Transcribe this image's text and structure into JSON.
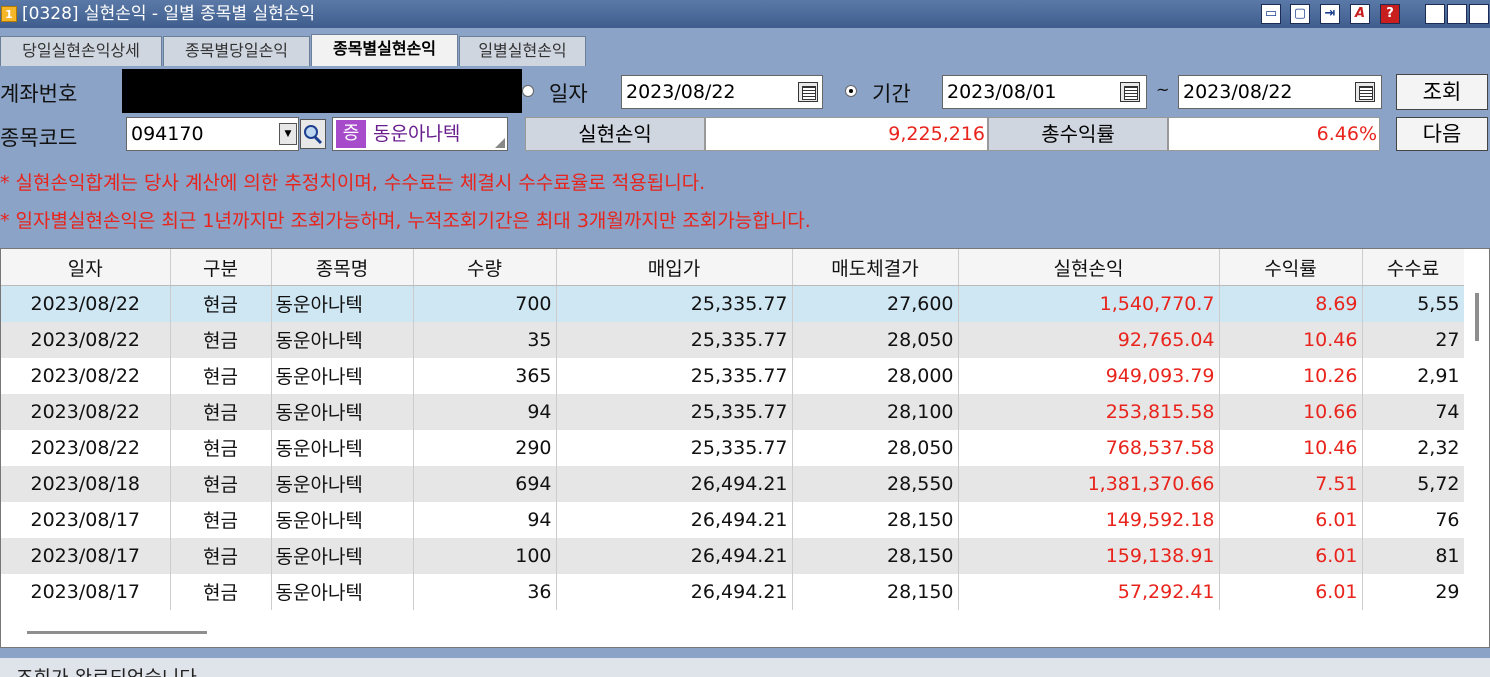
{
  "window": {
    "icon_text": "1",
    "title": "[0328] 실현손익 - 일별 종목별 실현손익",
    "buttons": [
      "▭",
      "▢",
      "⇥",
      "A",
      "?",
      "_",
      "□",
      "×"
    ]
  },
  "tabs": [
    {
      "label": "당일실현손익상세",
      "active": false
    },
    {
      "label": "종목별당일손익",
      "active": false
    },
    {
      "label": "종목별실현손익",
      "active": true
    },
    {
      "label": "일별실현손익",
      "active": false
    }
  ],
  "form": {
    "account_label": "계좌번호",
    "radio_date_label": "일자",
    "radio_period_label": "기간",
    "date_single": "2023/08/22",
    "date_from": "2023/08/01",
    "date_sep": "~",
    "date_to": "2023/08/22",
    "query_button": "조회",
    "next_button": "다음",
    "code_label": "종목코드",
    "code_value": "094170",
    "stock_badge": "증",
    "stock_name": "동운아나텍",
    "realized_label": "실현손익",
    "realized_value": "9,225,216",
    "total_return_label": "총수익률",
    "total_return_value": "6.46%"
  },
  "notes": [
    "* 실현손익합계는 당사 계산에 의한 추정치이며, 수수료는 체결시 수수료율로 적용됩니다.",
    "* 일자별실현손익은 최근 1년까지만 조회가능하며, 누적조회기간은 최대 3개월까지만 조회가능합니다."
  ],
  "table": {
    "columns": [
      "일자",
      "구분",
      "종목명",
      "수량",
      "매입가",
      "매도체결가",
      "실현손익",
      "수익률",
      "수수료"
    ],
    "rows": [
      [
        "2023/08/22",
        "현금",
        "동운아나텍",
        "700",
        "25,335.77",
        "27,600",
        "1,540,770.7",
        "8.69",
        "5,55"
      ],
      [
        "2023/08/22",
        "현금",
        "동운아나텍",
        "35",
        "25,335.77",
        "28,050",
        "92,765.04",
        "10.46",
        "27"
      ],
      [
        "2023/08/22",
        "현금",
        "동운아나텍",
        "365",
        "25,335.77",
        "28,000",
        "949,093.79",
        "10.26",
        "2,91"
      ],
      [
        "2023/08/22",
        "현금",
        "동운아나텍",
        "94",
        "25,335.77",
        "28,100",
        "253,815.58",
        "10.66",
        "74"
      ],
      [
        "2023/08/22",
        "현금",
        "동운아나텍",
        "290",
        "25,335.77",
        "28,050",
        "768,537.58",
        "10.46",
        "2,32"
      ],
      [
        "2023/08/18",
        "현금",
        "동운아나텍",
        "694",
        "26,494.21",
        "28,550",
        "1,381,370.66",
        "7.51",
        "5,72"
      ],
      [
        "2023/08/17",
        "현금",
        "동운아나텍",
        "94",
        "26,494.21",
        "28,150",
        "149,592.18",
        "6.01",
        "76"
      ],
      [
        "2023/08/17",
        "현금",
        "동운아나텍",
        "100",
        "26,494.21",
        "28,150",
        "159,138.91",
        "6.01",
        "81"
      ],
      [
        "2023/08/17",
        "현금",
        "동운아나텍",
        "36",
        "26,494.21",
        "28,150",
        "57,292.41",
        "6.01",
        "29"
      ]
    ],
    "selected_row": 0
  },
  "status": {
    "message": "조회가 완료되었습니다."
  },
  "colors": {
    "accent_red": "#e8241c",
    "selected_row": "#cfe6f3",
    "panel_bg": "#8aa3c6",
    "badge_purple": "#a64bc9"
  }
}
